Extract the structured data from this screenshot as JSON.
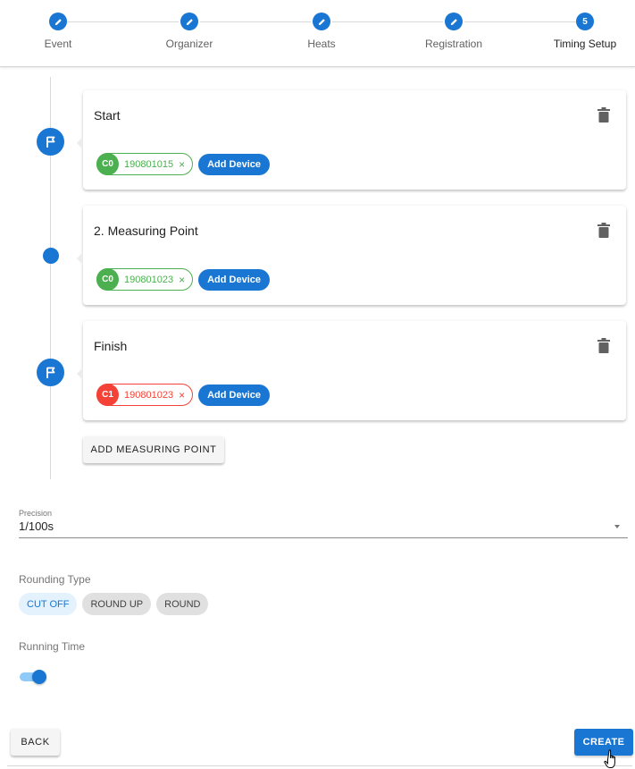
{
  "stepper": {
    "accent": "#1976d2",
    "steps": [
      {
        "label": "Event",
        "icon": "pencil-icon"
      },
      {
        "label": "Organizer",
        "icon": "pencil-icon"
      },
      {
        "label": "Heats",
        "icon": "pencil-icon"
      },
      {
        "label": "Registration",
        "icon": "pencil-icon"
      },
      {
        "label": "Timing Setup",
        "number": "5",
        "active": true
      }
    ]
  },
  "timeline": {
    "points": [
      {
        "title": "Start",
        "marker": "flag-icon",
        "device": {
          "channel": "C0",
          "serial": "190801015",
          "color": "#4caf50",
          "remove": "×"
        },
        "add_device_label": "Add Device",
        "delete_icon": "trash-icon"
      },
      {
        "title": "2. Measuring Point",
        "marker": "dot",
        "device": {
          "channel": "C0",
          "serial": "190801023",
          "color": "#4caf50",
          "remove": "×"
        },
        "add_device_label": "Add Device",
        "delete_icon": "trash-icon"
      },
      {
        "title": "Finish",
        "marker": "flag-icon",
        "device": {
          "channel": "C1",
          "serial": "190801023",
          "color": "#f44336",
          "remove": "×"
        },
        "add_device_label": "Add Device",
        "delete_icon": "trash-icon"
      }
    ],
    "add_point_label": "ADD MEASURING POINT"
  },
  "precision": {
    "label": "Precision",
    "value": "1/100s"
  },
  "rounding": {
    "label": "Rounding Type",
    "options": [
      "CUT OFF",
      "ROUND UP",
      "ROUND"
    ],
    "selected": "CUT OFF"
  },
  "running_time": {
    "label": "Running Time",
    "enabled": true
  },
  "actions": {
    "back_label": "BACK",
    "create_label": "CREATE"
  }
}
